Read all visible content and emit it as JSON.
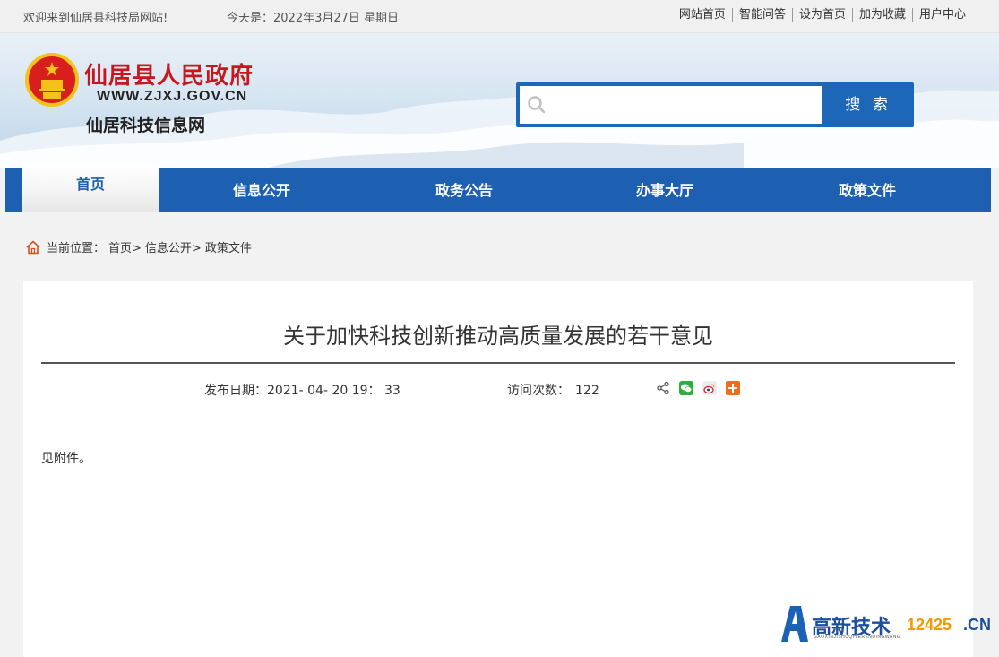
{
  "topbar": {
    "welcome": "欢迎来到仙居县科技局网站!",
    "today": "今天是：2022年3月27日 星期日",
    "links": [
      "网站首页",
      "智能问答",
      "设为首页",
      "加为收藏",
      "用户中心"
    ]
  },
  "header": {
    "title": "仙居县人民政府",
    "url": "WWW.ZJXJ.GOV.CN",
    "subtitle": "仙居科技信息网"
  },
  "search": {
    "placeholder": "",
    "button_label": "搜 索"
  },
  "nav": {
    "items": [
      "首页",
      "信息公开",
      "政务公告",
      "办事大厅",
      "政策文件"
    ],
    "active": "首页"
  },
  "breadcrumb": {
    "prefix": "当前位置：",
    "items": [
      "首页>",
      "信息公开>",
      "政策文件"
    ]
  },
  "article": {
    "title": "关于加快科技创新推动高质量发展的若干意见",
    "publish_label": "发布日期：",
    "publish_date": "2021- 04- 20 19： 33",
    "visits_label": "访问次数：",
    "visits": "122",
    "body": "见附件。"
  },
  "share_icons": [
    "share-icon",
    "wechat-icon",
    "weibo-icon",
    "plus-share-icon"
  ],
  "watermark": {
    "cn": "高新技术",
    "num": "12425",
    "tld": ".CN",
    "pinyin": "GAOXINJISHUQIYERENDINGWANG"
  },
  "colors": {
    "nav_blue": "#1d5fb0",
    "search_blue": "#1d67b8",
    "title_red": "#c8161d",
    "watermark_orange": "#f39800"
  }
}
